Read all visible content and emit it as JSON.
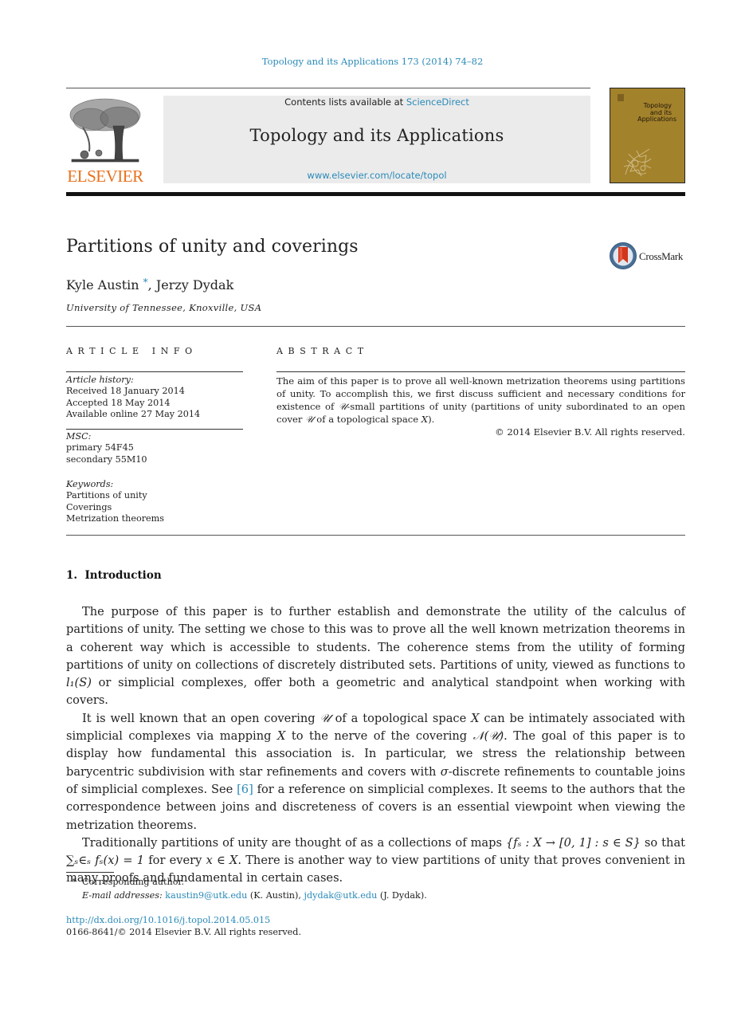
{
  "citation": "Topology and its Applications 173 (2014) 74–82",
  "header": {
    "contents_prefix": "Contents lists available at ",
    "contents_link": "ScienceDirect",
    "journal_title": "Topology and its Applications",
    "journal_url": "www.elsevier.com/locate/topol",
    "publisher_logo_text": "ELSEVIER",
    "cover_title_lines": [
      "Topology",
      "and its",
      "Applications"
    ]
  },
  "colors": {
    "link": "#2a8ab8",
    "elsevier_orange": "#e9711c",
    "cover_gold": "#a3822c",
    "header_box": "#ebebeb"
  },
  "paper": {
    "title": "Partitions of unity and coverings",
    "crossmark_label": "CrossMark",
    "authors": [
      {
        "name": "Kyle Austin",
        "mark": "*"
      },
      {
        "name": "Jerzy Dydak",
        "mark": ""
      }
    ],
    "author_separator": ", ",
    "affiliation": "University of Tennessee, Knoxville, USA"
  },
  "article_info": {
    "heading": "ARTICLE INFO",
    "history_label": "Article history:",
    "history": [
      "Received 18 January 2014",
      "Accepted 18 May 2014",
      "Available online 27 May 2014"
    ],
    "msc_label": "MSC:",
    "msc": [
      "primary 54F45",
      "secondary 55M10"
    ],
    "keywords_label": "Keywords:",
    "keywords": [
      "Partitions of unity",
      "Coverings",
      "Metrization theorems"
    ]
  },
  "abstract": {
    "heading": "ABSTRACT",
    "text_1": "The aim of this paper is to prove all well-known metrization theorems using partitions of unity. To accomplish this, we first discuss sufficient and necessary conditions for existence of ",
    "sym_U": "𝒰",
    "text_2": "-small partitions of unity (partitions of unity subordinated to an open cover ",
    "text_3": " of a topological space ",
    "sym_X": "X",
    "text_4": ").",
    "copyright": "© 2014 Elsevier B.V. All rights reserved."
  },
  "section": {
    "heading": "1.  Introduction"
  },
  "body": {
    "p1_a": "The purpose of this paper is to further establish and demonstrate the utility of the calculus of partitions of unity. The setting we chose to this was to prove all the well known metrization theorems in a coherent way which is accessible to students. The coherence stems from the utility of forming partitions of unity on collections of discretely distributed sets. Partitions of unity, viewed as functions to ",
    "p1_math": "l₁(S)",
    "p1_b": " or simplicial complexes, offer both a geometric and analytical standpoint when working with covers.",
    "p2_a": "It is well known that an open covering ",
    "p2_U": "𝒰",
    "p2_b": " of a topological space ",
    "p2_X": "X",
    "p2_c": " can be intimately associated with simplicial complexes via mapping ",
    "p2_X2": "X",
    "p2_d": " to the nerve of the covering ",
    "p2_NU": "𝒩(𝒰)",
    "p2_e": ". The goal of this paper is to display how fundamental this association is. In particular, we stress the relationship between barycentric subdivision with star refinements and covers with ",
    "p2_sigma": "σ",
    "p2_f": "-discrete refinements to countable joins of simplicial complexes. See ",
    "p2_ref": "[6]",
    "p2_g": " for a reference on simplicial complexes. It seems to the authors that the correspondence between joins and discreteness of covers is an essential viewpoint when viewing the metrization theorems.",
    "p3_a": "Traditionally partitions of unity are thought of as a collections of maps ",
    "p3_set": "{fₛ : X → [0, 1] : s ∈ S}",
    "p3_b": " so that ",
    "p3_sum": "∑ₛ∈ₛ fₛ(x) = 1",
    "p3_c": " for every ",
    "p3_xinX": "x ∈ X",
    "p3_d": ". There is another way to view partitions of unity that proves convenient in many proofs and fundamental in certain cases."
  },
  "footnotes": {
    "star": "*",
    "corresponding": "Corresponding author.",
    "email_label": "E-mail addresses:",
    "email_1": "kaustin9@utk.edu",
    "email_1_name": " (K. Austin), ",
    "email_2": "jdydak@utk.edu",
    "email_2_name": " (J. Dydak)."
  },
  "doi": {
    "url": "http://dx.doi.org/10.1016/j.topol.2014.05.015",
    "issn_line": "0166-8641/© 2014 Elsevier B.V. All rights reserved."
  }
}
